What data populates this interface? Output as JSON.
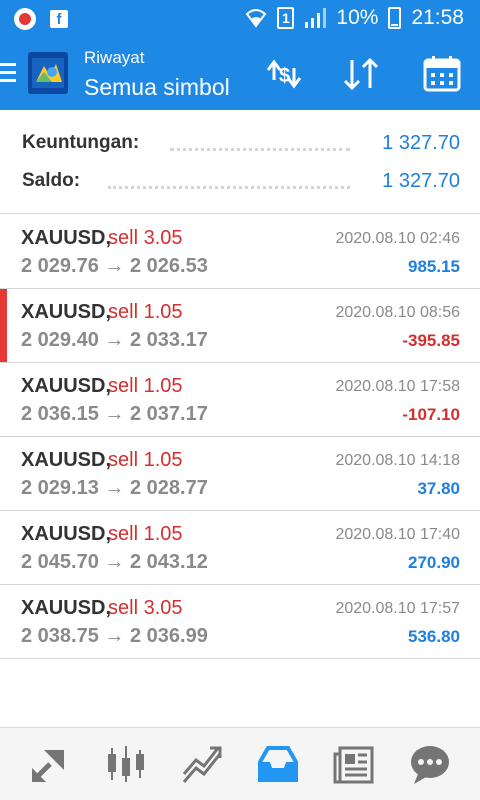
{
  "status_bar": {
    "sim_slot": "1",
    "battery": "10%",
    "time": "21:58"
  },
  "header": {
    "subtitle": "Riwayat",
    "title": "Semua simbol"
  },
  "summary": {
    "profit_label": "Keuntungan:",
    "profit_value": "1 327.70",
    "balance_label": "Saldo:",
    "balance_value": "1 327.70"
  },
  "trades": [
    {
      "symbol": "XAUUSD,",
      "type": "sell 3.05",
      "prices": "2 029.76 → 2 026.53",
      "time": "2020.08.10 02:46",
      "profit": "985.15"
    },
    {
      "symbol": "XAUUSD,",
      "type": "sell 1.05",
      "prices": "2 029.40 → 2 033.17",
      "time": "2020.08.10 08:56",
      "profit": "-395.85"
    },
    {
      "symbol": "XAUUSD,",
      "type": "sell 1.05",
      "prices": "2 036.15 → 2 037.17",
      "time": "2020.08.10 17:58",
      "profit": "-107.10"
    },
    {
      "symbol": "XAUUSD,",
      "type": "sell 1.05",
      "prices": "2 029.13 → 2 028.77",
      "time": "2020.08.10 14:18",
      "profit": "37.80"
    },
    {
      "symbol": "XAUUSD,",
      "type": "sell 1.05",
      "prices": "2 045.70 → 2 043.12",
      "time": "2020.08.10 17:40",
      "profit": "270.90"
    },
    {
      "symbol": "XAUUSD,",
      "type": "sell 3.05",
      "prices": "2 038.75 → 2 036.99",
      "time": "2020.08.10 17:57",
      "profit": "536.80"
    }
  ],
  "colors": {
    "primary": "#1e88e5",
    "profit_positive": "#1e7fe0",
    "profit_negative": "#d32f2f",
    "nav_active": "#2196f3",
    "nav_inactive": "#757575"
  },
  "bottom_nav": [
    "trade-icon",
    "quotes-icon",
    "chart-icon",
    "history-icon",
    "news-icon",
    "chat-icon"
  ],
  "bottom_nav_active": "history-icon"
}
